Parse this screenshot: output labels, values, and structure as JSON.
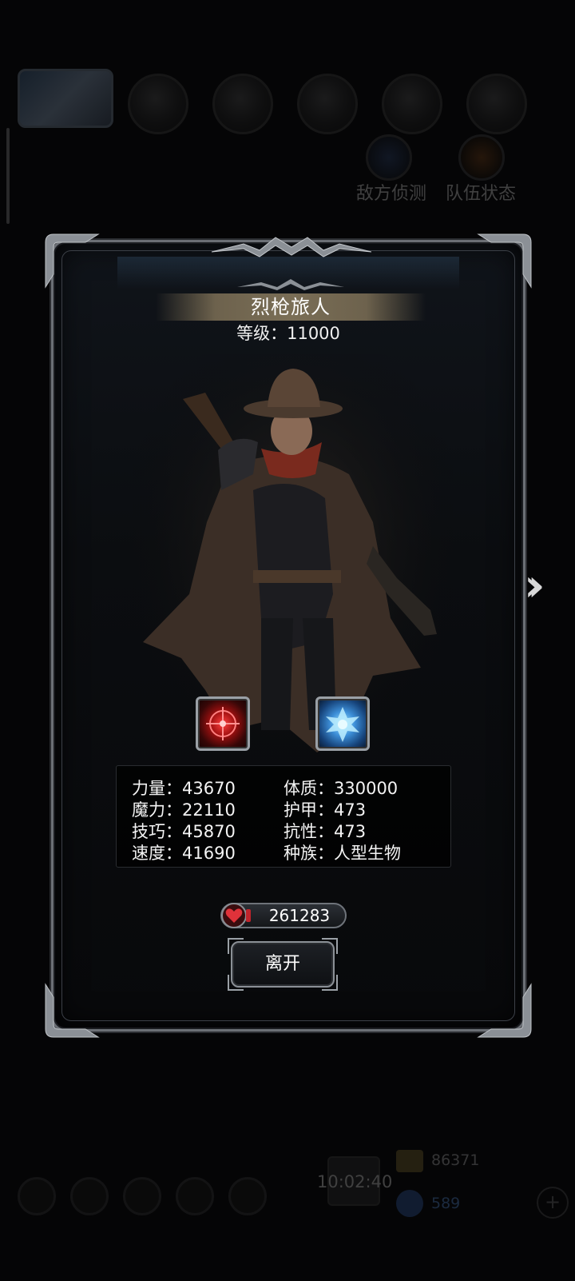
{
  "background": {
    "round_buttons": [
      "敌方侦测",
      "队伍状态"
    ],
    "clock": "10:02:40",
    "gold": "86371",
    "gems": "589"
  },
  "modal": {
    "name": "烈枪旅人",
    "level_label": "等级",
    "level_value": "11000",
    "skills": [
      {
        "icon": "crosshair-skill-icon",
        "color": "#c21818"
      },
      {
        "icon": "winged-cross-skill-icon",
        "color": "#3d8fd8"
      }
    ],
    "stats_left": [
      {
        "label": "力量",
        "value": "43670"
      },
      {
        "label": "魔力",
        "value": "22110"
      },
      {
        "label": "技巧",
        "value": "45870"
      },
      {
        "label": "速度",
        "value": "41690"
      }
    ],
    "stats_right": [
      {
        "label": "体质",
        "value": "330000"
      },
      {
        "label": "护甲",
        "value": "473"
      },
      {
        "label": "抗性",
        "value": "473"
      },
      {
        "label": "种族",
        "value": "人型生物"
      }
    ],
    "hp": "261283",
    "leave_label": "离开"
  },
  "colors": {
    "frame": "#6b6f75",
    "name_plate": "#7a6e56",
    "hp_red": "#c0242c"
  }
}
